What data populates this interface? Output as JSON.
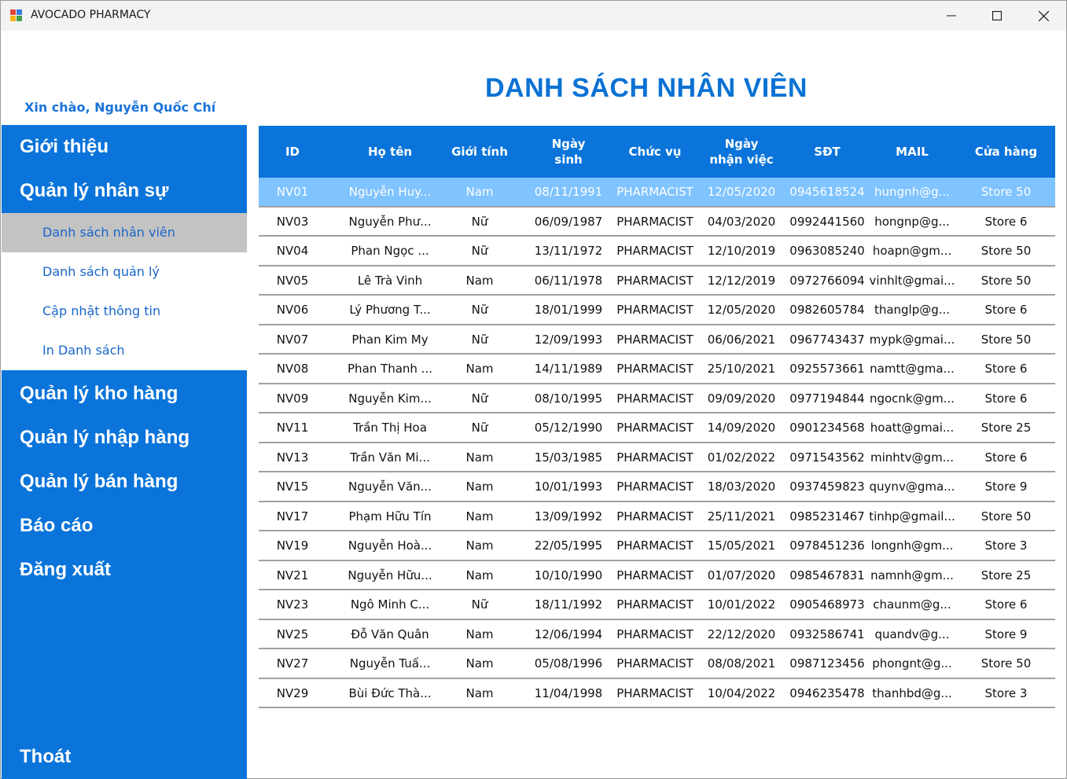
{
  "window": {
    "title": "AVOCADO PHARMACY",
    "icon": "app-window-icon",
    "controls": [
      "minimize-icon",
      "maximize-icon",
      "close-icon"
    ]
  },
  "greeting": "Xin chào, Nguyễn Quốc Chí",
  "page_title": "DANH SÁCH NHÂN VIÊN",
  "sidebar": {
    "items": [
      {
        "label": "Giới thiệu"
      },
      {
        "label": "Quản lý nhân sự"
      },
      {
        "label": "Quản lý kho hàng"
      },
      {
        "label": "Quản lý nhập hàng"
      },
      {
        "label": "Quản lý bán hàng"
      },
      {
        "label": "Báo cáo"
      },
      {
        "label": "Đăng xuất"
      }
    ],
    "submenu": [
      {
        "label": "Danh sách nhân viên",
        "active": true
      },
      {
        "label": "Danh sách quản lý"
      },
      {
        "label": "Cập nhật thông tin"
      },
      {
        "label": "In Danh sách"
      }
    ],
    "exit": "Thoát"
  },
  "table": {
    "columns": [
      {
        "label": "ID"
      },
      {
        "label": "Họ tên"
      },
      {
        "label": "Giới tính"
      },
      {
        "label": "Ngày\nsinh"
      },
      {
        "label": "Chức vụ"
      },
      {
        "label": "Ngày\nnhận việc"
      },
      {
        "label": "SĐT"
      },
      {
        "label": "MAIL"
      },
      {
        "label": "Cửa hàng"
      }
    ],
    "rows": [
      [
        "NV01",
        "Nguyễn Huy...",
        "Nam",
        "08/11/1991",
        "PHARMACIST",
        "12/05/2020",
        "0945618524",
        "hungnh@g...",
        "Store 50"
      ],
      [
        "NV03",
        "Nguyễn Phư...",
        "Nữ",
        "06/09/1987",
        "PHARMACIST",
        "04/03/2020",
        "0992441560",
        "hongnp@g...",
        "Store 6"
      ],
      [
        "NV04",
        "Phan Ngọc ...",
        "Nữ",
        "13/11/1972",
        "PHARMACIST",
        "12/10/2019",
        "0963085240",
        "hoapn@gm...",
        "Store 50"
      ],
      [
        "NV05",
        "Lê Trà Vinh",
        "Nam",
        "06/11/1978",
        "PHARMACIST",
        "12/12/2019",
        "0972766094",
        "vinhlt@gmai...",
        "Store 50"
      ],
      [
        "NV06",
        "Lý Phương T...",
        "Nữ",
        "18/01/1999",
        "PHARMACIST",
        "12/05/2020",
        "0982605784",
        "thanglp@g...",
        "Store 6"
      ],
      [
        "NV07",
        "Phan Kim My",
        "Nữ",
        "12/09/1993",
        "PHARMACIST",
        "06/06/2021",
        "0967743437",
        "mypk@gmai...",
        "Store 50"
      ],
      [
        "NV08",
        "Phan Thanh ...",
        "Nam",
        "14/11/1989",
        "PHARMACIST",
        "25/10/2021",
        "0925573661",
        "namtt@gma...",
        "Store 6"
      ],
      [
        "NV09",
        "Nguyễn Kim...",
        "Nữ",
        "08/10/1995",
        "PHARMACIST",
        "09/09/2020",
        "0977194844",
        "ngocnk@gm...",
        "Store 6"
      ],
      [
        "NV11",
        "Trần Thị Hoa",
        "Nữ",
        "05/12/1990",
        "PHARMACIST",
        "14/09/2020",
        "0901234568",
        "hoatt@gmai...",
        "Store 25"
      ],
      [
        "NV13",
        "Trần Văn Mi...",
        "Nam",
        "15/03/1985",
        "PHARMACIST",
        "01/02/2022",
        "0971543562",
        "minhtv@gm...",
        "Store 6"
      ],
      [
        "NV15",
        "Nguyễn Văn...",
        "Nam",
        "10/01/1993",
        "PHARMACIST",
        "18/03/2020",
        "0937459823",
        "quynv@gma...",
        "Store 9"
      ],
      [
        "NV17",
        "Phạm Hữu Tín",
        "Nam",
        "13/09/1992",
        "PHARMACIST",
        "25/11/2021",
        "0985231467",
        "tinhp@gmail...",
        "Store 50"
      ],
      [
        "NV19",
        "Nguyễn Hoà...",
        "Nam",
        "22/05/1995",
        "PHARMACIST",
        "15/05/2021",
        "0978451236",
        "longnh@gm...",
        "Store 3"
      ],
      [
        "NV21",
        "Nguyễn Hữu...",
        "Nam",
        "10/10/1990",
        "PHARMACIST",
        "01/07/2020",
        "0985467831",
        "namnh@gm...",
        "Store 25"
      ],
      [
        "NV23",
        "Ngô Minh C...",
        "Nữ",
        "18/11/1992",
        "PHARMACIST",
        "10/01/2022",
        "0905468973",
        "chaunm@g...",
        "Store 6"
      ],
      [
        "NV25",
        "Đỗ Văn Quân",
        "Nam",
        "12/06/1994",
        "PHARMACIST",
        "22/12/2020",
        "0932586741",
        "quandv@g...",
        "Store 9"
      ],
      [
        "NV27",
        "Nguyễn Tuấ...",
        "Nam",
        "05/08/1996",
        "PHARMACIST",
        "08/08/2021",
        "0987123456",
        "phongnt@g...",
        "Store 50"
      ],
      [
        "NV29",
        "Bùi Đức Thà...",
        "Nam",
        "11/04/1998",
        "PHARMACIST",
        "10/04/2022",
        "0946235478",
        "thanhbd@g...",
        "Store 3"
      ]
    ],
    "selected_row": 0
  },
  "colors": {
    "primary": "#0a74da",
    "selected_row": "#7fc3ff",
    "submenu_active": "#c3c3c3",
    "title": "#0a72d4"
  }
}
